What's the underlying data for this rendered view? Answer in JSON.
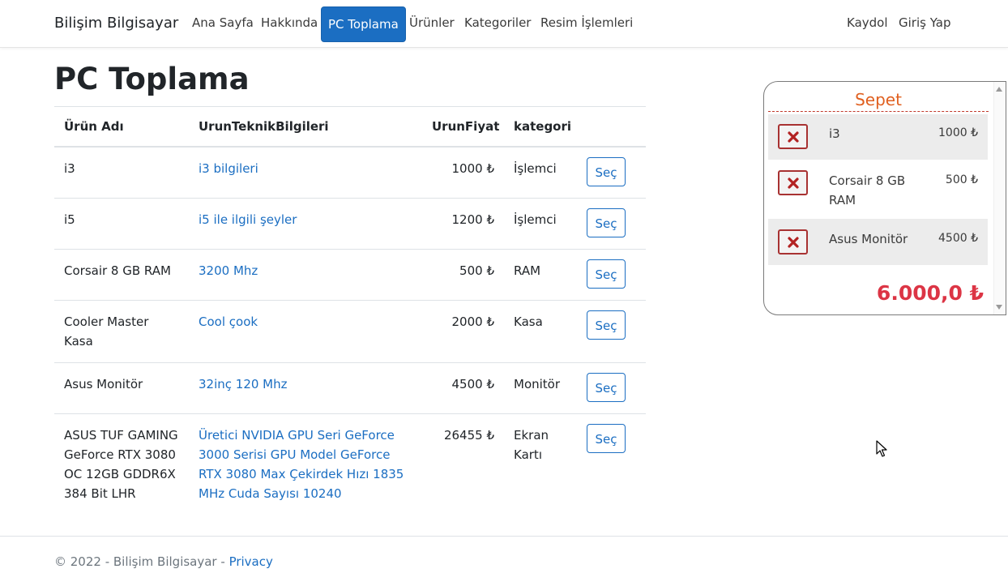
{
  "navbar": {
    "brand": "Bilişim Bilgisayar",
    "links": [
      "Ana Sayfa",
      "Hakkında",
      "PC Toplama",
      "Ürünler",
      "Kategoriler",
      "Resim İşlemleri"
    ],
    "active_link": "PC Toplama",
    "right_links": [
      "Kaydol",
      "Giriş Yap"
    ]
  },
  "page": {
    "title": "PC Toplama"
  },
  "table": {
    "headers": [
      "Ürün Adı",
      "UrunTeknikBilgileri",
      "UrunFiyat",
      "kategori"
    ],
    "select_label": "Seç",
    "rows": [
      {
        "name": "i3",
        "info": "i3 bilgileri",
        "price": "1000 ₺",
        "category": "İşlemci"
      },
      {
        "name": "i5",
        "info": "i5 ile ilgili şeyler",
        "price": "1200 ₺",
        "category": "İşlemci"
      },
      {
        "name": "Corsair 8 GB RAM",
        "info": "3200 Mhz",
        "price": "500 ₺",
        "category": "RAM"
      },
      {
        "name": "Cooler Master Kasa",
        "info": "Cool çook",
        "price": "2000 ₺",
        "category": "Kasa"
      },
      {
        "name": "Asus Monitör",
        "info": "32inç 120 Mhz",
        "price": "4500 ₺",
        "category": "Monitör"
      },
      {
        "name": "ASUS TUF GAMING GeForce RTX 3080 OC 12GB GDDR6X 384 Bit LHR",
        "info": "Üretici NVIDIA GPU Seri GeForce 3000 Serisi GPU Model GeForce RTX 3080 Max Çekirdek Hızı 1835 MHz Cuda Sayısı 10240",
        "price": "26455 ₺",
        "category": "Ekran Kartı"
      }
    ]
  },
  "cart": {
    "title": "Sepet",
    "items": [
      {
        "name": "i3",
        "price": "1000 ₺"
      },
      {
        "name": "Corsair 8 GB RAM",
        "price": "500 ₺"
      },
      {
        "name": "Asus Monitör",
        "price": "4500 ₺"
      }
    ],
    "total": "6.000,0 ₺"
  },
  "footer": {
    "copyright": "© 2022 - Bilişim Bilgisayar - ",
    "privacy": "Privacy"
  },
  "colors": {
    "primary": "#1b6ec2",
    "cart_title": "#e06020",
    "total": "#dc3545",
    "remove_border": "#a83232"
  }
}
